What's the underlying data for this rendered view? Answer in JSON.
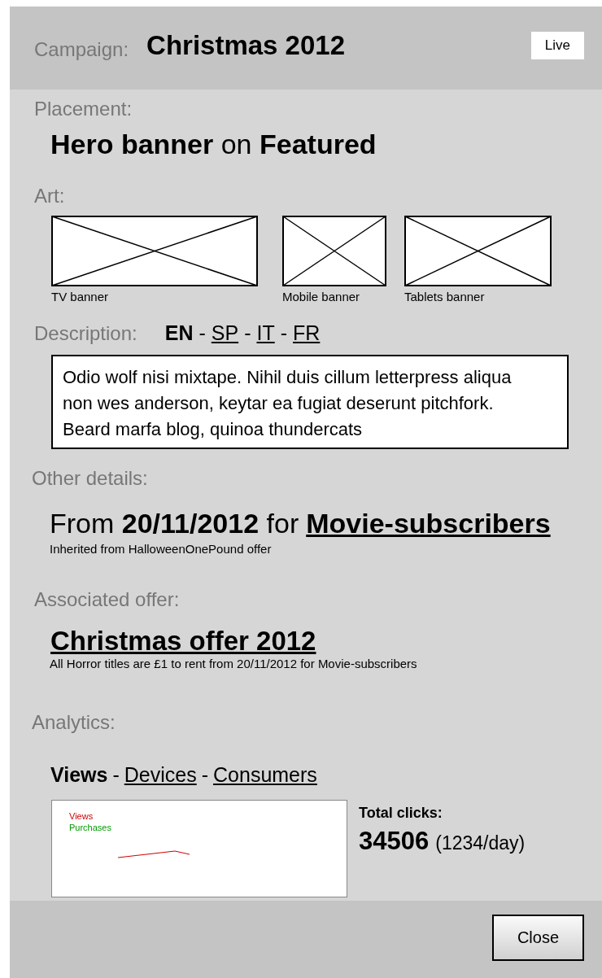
{
  "header": {
    "label": "Campaign:",
    "title": "Christmas 2012",
    "status": "Live"
  },
  "placement": {
    "label": "Placement:",
    "value": "**Hero banner** on **Featured**"
  },
  "art": {
    "label": "Art:",
    "items": [
      {
        "caption": "TV banner",
        "kind": "wide"
      },
      {
        "caption": "Mobile banner",
        "kind": "square"
      },
      {
        "caption": "Tablets banner",
        "kind": "medium"
      }
    ]
  },
  "description": {
    "label": "Description:",
    "separator": "-",
    "languages": [
      {
        "label": "EN",
        "selected": true
      },
      {
        "label": "SP",
        "selected": false
      },
      {
        "label": "IT",
        "selected": false
      },
      {
        "label": "FR",
        "selected": false
      }
    ],
    "text": "Odio wolf nisi mixtape. Nihil duis cillum letterpress aliqua non wes anderson, keytar ea fugiat deserunt pitchfork. Beard marfa blog, quinoa thundercats"
  },
  "other_details": {
    "label": "Other details:",
    "text": "From **20/11/2012** for",
    "audience": "Movie-subscribers",
    "note": "Inherited from HalloweenOnePound offer"
  },
  "associated_offer": {
    "label": "Associated offer:",
    "title": "Christmas offer 2012",
    "summary": "All Horror titles are £1 to rent from 20/11/2012 for Movie-subscribers"
  },
  "analytics": {
    "label": "Analytics:",
    "separator": "-",
    "tabs": [
      {
        "label": "Views",
        "selected": true
      },
      {
        "label": "Devices",
        "selected": false
      },
      {
        "label": "Consumers",
        "selected": false
      }
    ],
    "legend": [
      {
        "name": "Views",
        "color": "#cc0000"
      },
      {
        "name": "Purchases",
        "color": "#009900"
      }
    ],
    "total_label": "Total clicks:",
    "total": "34506",
    "per_day": "(1234/day)"
  },
  "footer": {
    "button": "Close"
  }
}
